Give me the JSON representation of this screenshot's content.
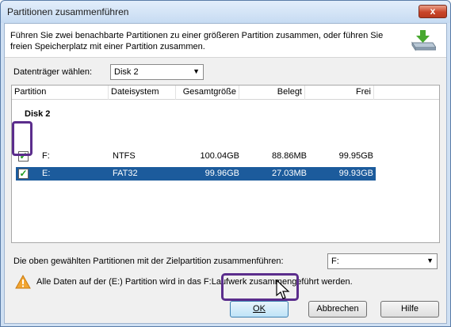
{
  "window": {
    "title": "Partitionen zusammenführen",
    "close_glyph": "x"
  },
  "header": {
    "description": "Führen Sie zwei benachbarte Partitionen zu einer größeren Partition zusammen, oder führen Sie freien Speicherplatz mit einer Partition zusammen.",
    "icon": "disk-merge-icon"
  },
  "disk_select": {
    "label": "Datenträger wählen:",
    "value": "Disk 2"
  },
  "table": {
    "columns": [
      "Partition",
      "Dateisystem",
      "Gesamtgröße",
      "Belegt",
      "Frei"
    ],
    "group": "Disk 2",
    "rows": [
      {
        "partition": "F:",
        "filesystem": "NTFS",
        "total": "100.04GB",
        "used": "88.86MB",
        "free": "99.95GB",
        "checked": true,
        "selected": false
      },
      {
        "partition": "E:",
        "filesystem": "FAT32",
        "total": "99.96GB",
        "used": "27.03MB",
        "free": "99.93GB",
        "checked": true,
        "selected": true
      }
    ],
    "selection_color": "#1c5b9c"
  },
  "merge": {
    "label": "Die oben gewählten Partitionen mit der Zielpartition zusammenführen:",
    "target_value": "F:"
  },
  "warning": {
    "text": "Alle Daten auf der (E:) Partition wird in das F:Laufwerk zusammengeführt werden.",
    "icon": "warning-icon"
  },
  "buttons": {
    "ok": "OK",
    "cancel": "Abbrechen",
    "help": "Hilfe"
  },
  "annotation_color": "#5b2d8c"
}
